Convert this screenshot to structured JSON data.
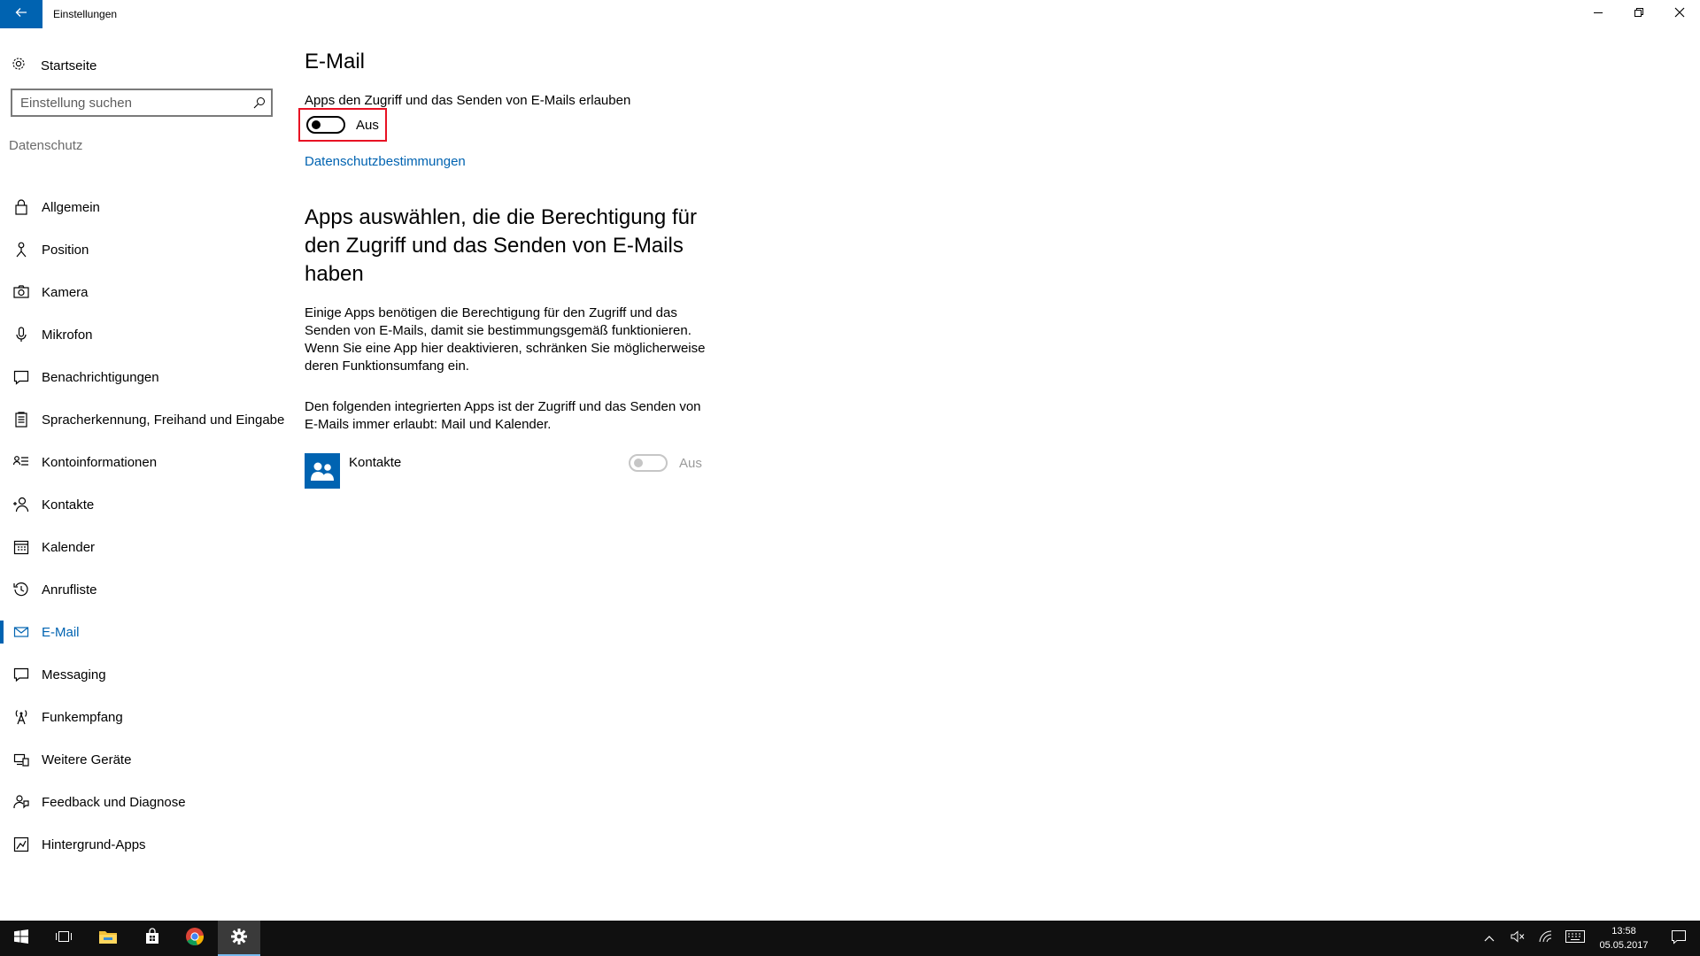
{
  "window": {
    "title": "Einstellungen",
    "back_icon": "arrow-left-icon",
    "controls": [
      "minimize-icon",
      "restore-icon",
      "close-icon"
    ]
  },
  "sidebar": {
    "home_label": "Startseite",
    "search_placeholder": "Einstellung suchen",
    "section_header": "Datenschutz",
    "items": [
      {
        "label": "Allgemein",
        "icon": "lock-icon"
      },
      {
        "label": "Position",
        "icon": "location-person-icon"
      },
      {
        "label": "Kamera",
        "icon": "camera-icon"
      },
      {
        "label": "Mikrofon",
        "icon": "microphone-icon"
      },
      {
        "label": "Benachrichtigungen",
        "icon": "message-bubble-icon"
      },
      {
        "label": "Spracherkennung, Freihand und Eingabe",
        "icon": "clipboard-icon"
      },
      {
        "label": "Kontoinformationen",
        "icon": "account-info-icon"
      },
      {
        "label": "Kontakte",
        "icon": "contacts-icon"
      },
      {
        "label": "Kalender",
        "icon": "calendar-icon"
      },
      {
        "label": "Anrufliste",
        "icon": "history-icon"
      },
      {
        "label": "E-Mail",
        "icon": "mail-icon",
        "active": true
      },
      {
        "label": "Messaging",
        "icon": "chat-icon"
      },
      {
        "label": "Funkempfang",
        "icon": "antenna-icon"
      },
      {
        "label": "Weitere Geräte",
        "icon": "devices-icon"
      },
      {
        "label": "Feedback und Diagnose",
        "icon": "feedback-icon"
      },
      {
        "label": "Hintergrund-Apps",
        "icon": "background-apps-icon"
      }
    ]
  },
  "main": {
    "title": "E-Mail",
    "allow_label": "Apps den Zugriff und das Senden von E-Mails erlauben",
    "allow_toggle_state": "Aus",
    "allow_toggle_on": false,
    "privacy_link": "Datenschutzbestimmungen",
    "sub_heading": "Apps auswählen, die die Berechtigung für den Zugriff und das Senden von E-Mails haben",
    "description": "Einige Apps benötigen die Berechtigung für den Zugriff und das Senden von E-Mails, damit sie bestimmungsgemäß funktionieren. Wenn Sie eine App hier deaktivieren, schränken Sie möglicherweise deren Funktionsumfang ein.",
    "builtin_note": "Den folgenden integrierten Apps ist der Zugriff und das Senden von E-Mails immer erlaubt: Mail und Kalender.",
    "apps": [
      {
        "name": "Kontakte",
        "toggle_state": "Aus",
        "enabled": false,
        "icon": "people-icon"
      }
    ]
  },
  "taskbar": {
    "buttons": [
      "windows-start-icon",
      "task-view-icon",
      "file-explorer-icon",
      "store-icon",
      "chrome-icon",
      "settings-gear-icon"
    ],
    "active": "settings-gear-icon",
    "tray_icons": [
      "chevron-up-icon",
      "volume-muted-icon",
      "wifi-icon",
      "keyboard-icon"
    ],
    "time": "13:58",
    "date": "05.05.2017"
  },
  "colors": {
    "accent": "#0063b1",
    "highlight_box": "#e81123",
    "taskbar": "#101010"
  }
}
